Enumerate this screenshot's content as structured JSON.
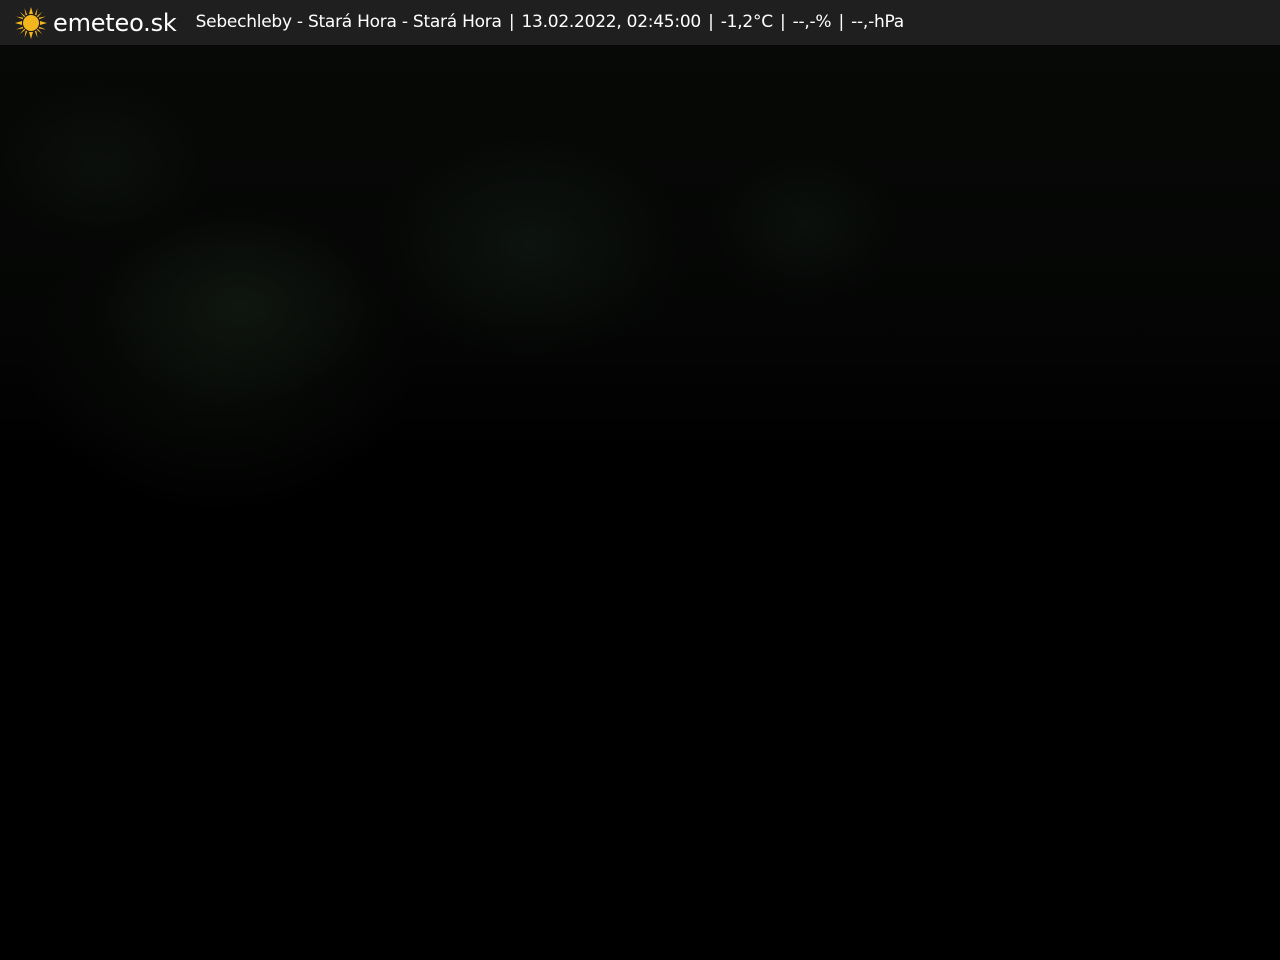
{
  "header": {
    "brand": "emeteo.sk",
    "location": "Sebechleby - Stará Hora - Stará Hora",
    "datetime": "13.02.2022, 02:45:00",
    "temperature": "-1,2°C",
    "humidity": "--,-%",
    "pressure": "--,-hPa",
    "separator": "|",
    "icon": "sun-icon"
  },
  "colors": {
    "topbar_background": "#1f1f1f",
    "sun_icon": "#f4b51e",
    "text": "#ffffff",
    "image_background": "#000000"
  }
}
